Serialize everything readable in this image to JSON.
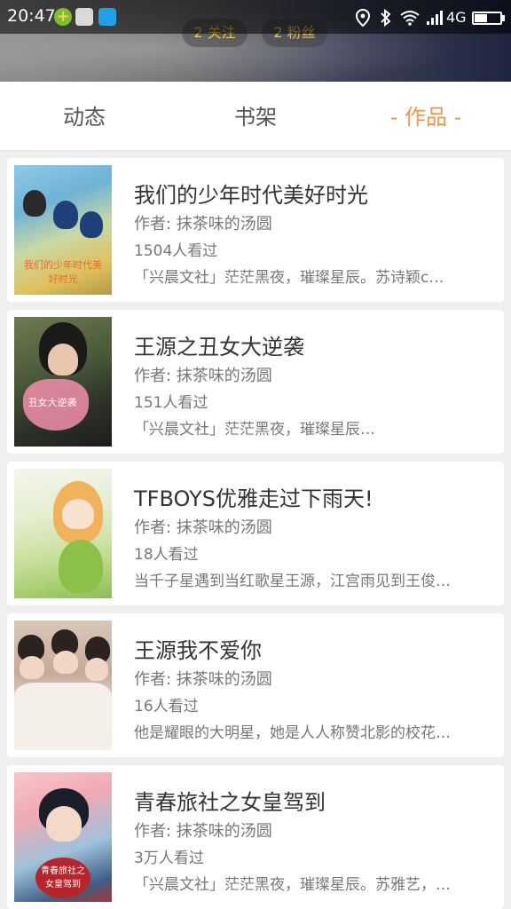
{
  "status_bar": {
    "time": "20:47",
    "network": "4G"
  },
  "profile": {
    "follow_count": "2 关注",
    "fans_count": "2 粉丝"
  },
  "tabs": [
    {
      "label": "动态"
    },
    {
      "label": "书架"
    },
    {
      "label": "- 作品 -"
    }
  ],
  "works": [
    {
      "title": "我们的少年时代美好时光",
      "author": "作者: 抹茶味的汤圆",
      "views": "1504人看过",
      "desc": "「兴晨文社」茫茫黑夜，璀璨星辰。苏诗颖c…",
      "cover_text": "我们的少年时代美好时光"
    },
    {
      "title": "王源之丑女大逆袭",
      "author": "作者: 抹茶味的汤圆",
      "views": "151人看过",
      "desc": "「兴晨文社」茫茫黑夜，璀璨星辰…",
      "cover_text": "丑女大逆袭"
    },
    {
      "title": "TFBOYS优雅走过下雨天!",
      "author": "作者: 抹茶味的汤圆",
      "views": "18人看过",
      "desc": "当千子星遇到当红歌星王源，江宫雨见到王俊…",
      "cover_text": ""
    },
    {
      "title": "王源我不爱你",
      "author": "作者: 抹茶味的汤圆",
      "views": "16人看过",
      "desc": "他是耀眼的大明星，她是人人称赞北影的校花…",
      "cover_text": ""
    },
    {
      "title": "青春旅社之女皇驾到",
      "author": "作者: 抹茶味的汤圆",
      "views": "3万人看过",
      "desc": "「兴晨文社」茫茫黑夜，璀璨星辰。苏雅艺，…",
      "cover_text": "青春旅社之女皇驾到"
    }
  ]
}
